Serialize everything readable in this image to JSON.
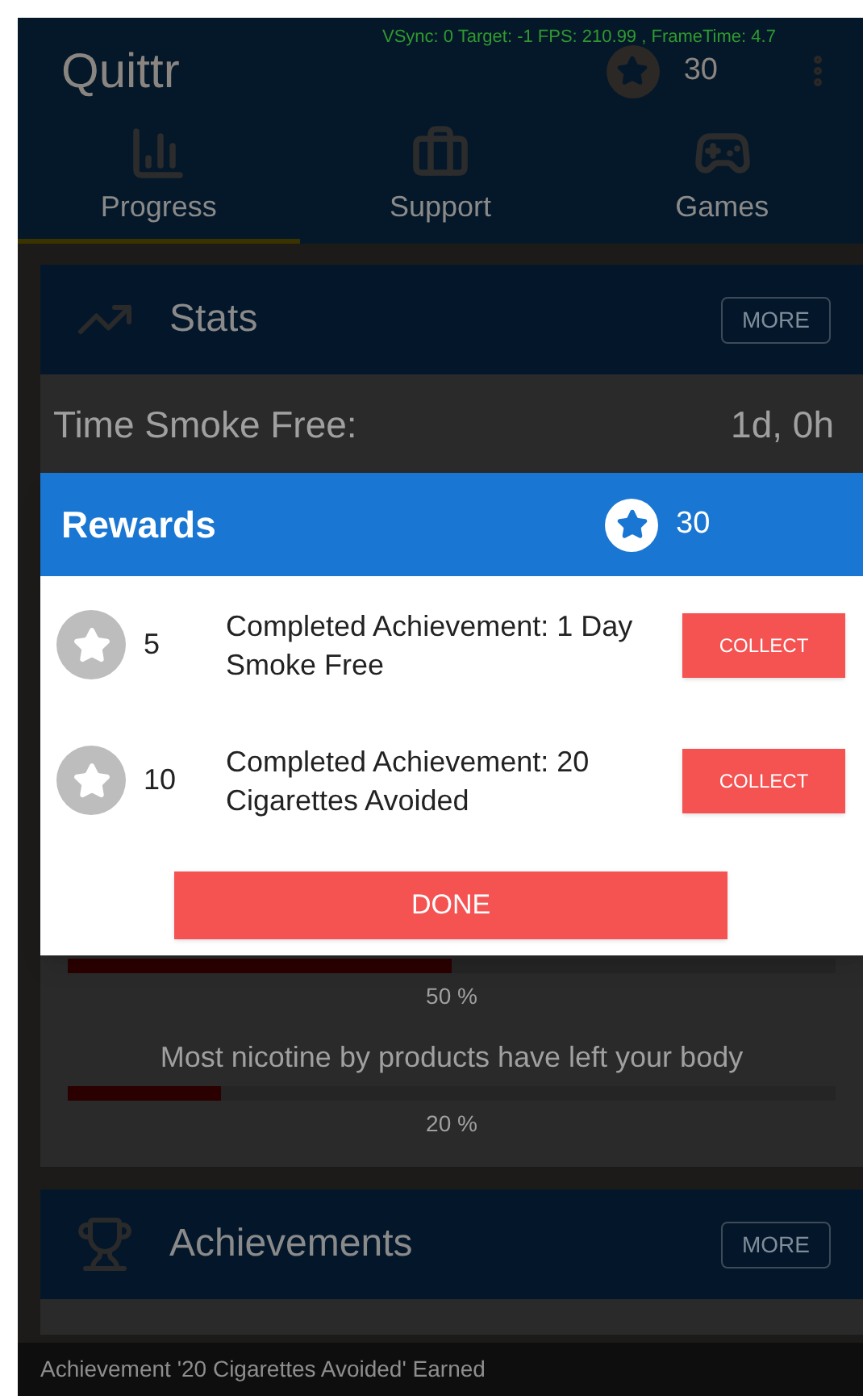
{
  "debug_overlay": "VSync: 0 Target: -1 FPS: 210.99 , FrameTime: 4.7",
  "app_bar": {
    "title": "Quittr",
    "points": "30"
  },
  "tabs": [
    {
      "label": "Progress",
      "kind": "progress",
      "selected": true
    },
    {
      "label": "Support",
      "kind": "support",
      "selected": false
    },
    {
      "label": "Games",
      "kind": "games",
      "selected": false
    }
  ],
  "stats_card": {
    "title": "Stats",
    "more_button": "MORE",
    "time_label": "Time Smoke Free:",
    "time_value": "1d, 0h",
    "progress_items": [
      {
        "level": 0.5,
        "reading": "50 %"
      },
      {
        "label": "Most nicotine by products have left your body",
        "level": 0.2,
        "reading": "20 %"
      }
    ]
  },
  "achievements_card": {
    "title": "Achievements",
    "more_button": "MORE"
  },
  "snackbar": "Achievement '20 Cigarettes Avoided' Earned",
  "dialog": {
    "title": "Rewards",
    "points": "30",
    "rewards": [
      {
        "points": "5",
        "description": "Completed Achievement: 1 Day Smoke Free",
        "button": "COLLECT"
      },
      {
        "points": "10",
        "description": "Completed Achievement: 20 Cigarettes Avoided",
        "button": "COLLECT"
      }
    ],
    "done_button": "DONE"
  }
}
